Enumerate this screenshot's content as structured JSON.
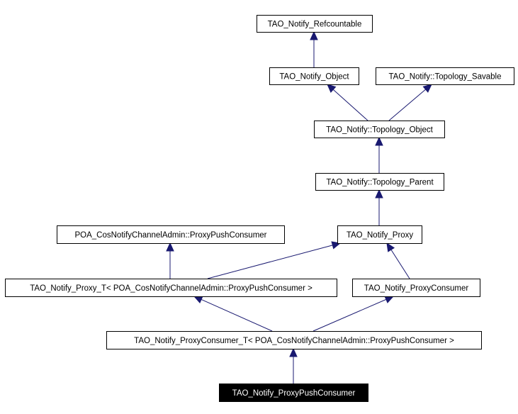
{
  "diagram": {
    "edge_color": "#191970",
    "highlight_fill": "#000000",
    "highlight_text": "#ffffff",
    "nodes": [
      {
        "id": "refcountable",
        "label": "TAO_Notify_Refcountable"
      },
      {
        "id": "object",
        "label": "TAO_Notify_Object"
      },
      {
        "id": "savable",
        "label": "TAO_Notify::Topology_Savable"
      },
      {
        "id": "topo_object",
        "label": "TAO_Notify::Topology_Object"
      },
      {
        "id": "topo_parent",
        "label": "TAO_Notify::Topology_Parent"
      },
      {
        "id": "poa_ppc",
        "label": "POA_CosNotifyChannelAdmin::ProxyPushConsumer"
      },
      {
        "id": "proxy",
        "label": "TAO_Notify_Proxy"
      },
      {
        "id": "proxy_t",
        "label": "TAO_Notify_Proxy_T< POA_CosNotifyChannelAdmin::ProxyPushConsumer >"
      },
      {
        "id": "proxy_consumer",
        "label": "TAO_Notify_ProxyConsumer"
      },
      {
        "id": "proxy_consumer_t",
        "label": "TAO_Notify_ProxyConsumer_T< POA_CosNotifyChannelAdmin::ProxyPushConsumer >"
      },
      {
        "id": "proxy_push_consumer",
        "label": "TAO_Notify_ProxyPushConsumer",
        "highlighted": true
      }
    ],
    "edges": [
      {
        "from": "object",
        "to": "refcountable"
      },
      {
        "from": "topo_object",
        "to": "object"
      },
      {
        "from": "topo_object",
        "to": "savable"
      },
      {
        "from": "topo_parent",
        "to": "topo_object"
      },
      {
        "from": "proxy",
        "to": "topo_parent"
      },
      {
        "from": "proxy_t",
        "to": "poa_ppc"
      },
      {
        "from": "proxy_t",
        "to": "proxy"
      },
      {
        "from": "proxy_consumer",
        "to": "proxy"
      },
      {
        "from": "proxy_consumer_t",
        "to": "proxy_t"
      },
      {
        "from": "proxy_consumer_t",
        "to": "proxy_consumer"
      },
      {
        "from": "proxy_push_consumer",
        "to": "proxy_consumer_t"
      }
    ]
  }
}
